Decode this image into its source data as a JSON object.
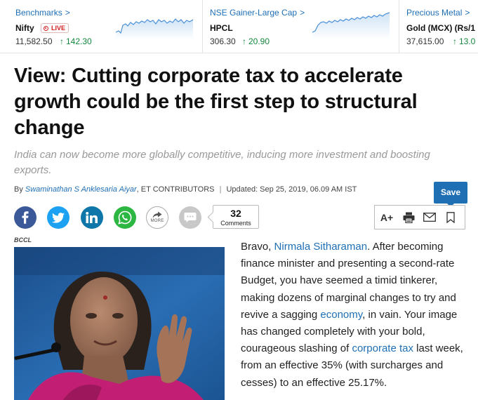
{
  "ticker": [
    {
      "category": "Benchmarks",
      "name": "Nifty",
      "live_label": "LIVE",
      "value": "11,582.50",
      "change": "142.30"
    },
    {
      "category": "NSE Gainer-Large Cap",
      "name": "HPCL",
      "value": "306.30",
      "change": "20.90"
    },
    {
      "category": "Precious Metal",
      "name": "Gold (MCX) (Rs/1",
      "value": "37,615.00",
      "change": "13.0"
    }
  ],
  "chevron": ">",
  "up_arrow": "↑",
  "article": {
    "headline": "View: Cutting corporate tax to accelerate growth could be the first step to structural change",
    "synopsis": "India can now become more globally competitive, inducing more investment and boosting exports.",
    "byline_prefix": "By",
    "author": "Swaminathan S Anklesaria Aiyar",
    "author_org": ", ET CONTRIBUTORS",
    "separator": "|",
    "updated": "Updated: Sep 25, 2019, 06.09 AM IST",
    "image_credit": "BCCL",
    "body": [
      {
        "t": "Bravo, "
      },
      {
        "t": "Nirmala Sitharaman",
        "link": true
      },
      {
        "t": ". After becoming finance minister and presenting a second-rate Budget, you have seemed a timid tinkerer, making dozens of marginal changes to try and revive a sagging "
      },
      {
        "t": "economy",
        "link": true
      },
      {
        "t": ", in vain. Your image has changed completely with your bold, courageous slashing of "
      },
      {
        "t": "corporate tax",
        "link": true
      },
      {
        "t": " last week, from an effective 35% (with surcharges and cesses) to an effective 25.17%."
      }
    ]
  },
  "share": {
    "more_label": "MORE",
    "comments_count": "32",
    "comments_label": "Comments"
  },
  "tools": {
    "save_label": "Save",
    "font_size_label": "A+"
  },
  "colors": {
    "link": "#1f6fb5",
    "positive": "#15863c",
    "live": "#d31f1f",
    "facebook": "#3b5998",
    "twitter": "#1da1f2",
    "linkedin": "#0e76a8",
    "whatsapp": "#2cb742"
  },
  "icons": [
    "facebook-icon",
    "twitter-icon",
    "linkedin-icon",
    "whatsapp-icon",
    "share-more-icon",
    "comment-icon",
    "print-icon",
    "email-icon",
    "bookmark-icon"
  ]
}
